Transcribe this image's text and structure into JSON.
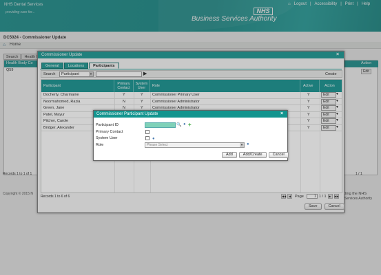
{
  "header": {
    "brand": "NHS Dental Services",
    "brand_sub": "providing care for...",
    "links": [
      "Logout",
      "Accessibility",
      "Print",
      "Help"
    ],
    "nhs_logo": "NHS",
    "org": "Business Services Authority"
  },
  "page": {
    "title": "DC5024 - Commissioner Update",
    "breadcrumb": "Home"
  },
  "background": {
    "tabs": [
      "Search",
      "Health Bo"
    ],
    "header_col": "Health Body Co",
    "header_action": "Action",
    "row_value": "Q59",
    "edit": "Edit",
    "records": "Records 1 to 1 of 1",
    "pager": "1 / 1",
    "copyright": "Copyright © 2015 N",
    "footer_right": "ecting the NHS",
    "footer_right2": "Services Authority"
  },
  "dialog": {
    "title": "Commissioner Update",
    "tabs": [
      "General",
      "Locations",
      "Participants"
    ],
    "active_tab": "Participants",
    "search_label": "Search",
    "search_select": "Participant",
    "search_value": "",
    "create": "Create",
    "columns": [
      "Participant",
      "Primary Contact",
      "System User",
      "Role",
      "Active",
      "Action"
    ],
    "rows": [
      {
        "participant": "Docherty, Charmaine",
        "primary": "Y",
        "system": "Y",
        "role": "Commissioner Primary User",
        "active": "Y",
        "action": "Edit"
      },
      {
        "participant": "Noormahomed, Razia",
        "primary": "N",
        "system": "Y",
        "role": "Commissioner Administrator",
        "active": "Y",
        "action": "Edit"
      },
      {
        "participant": "Green, Jane",
        "primary": "N",
        "system": "Y",
        "role": "Commissioner Administrator",
        "active": "Y",
        "action": "Edit"
      },
      {
        "participant": "Patel, Mayur",
        "primary": "",
        "system": "",
        "role": "",
        "active": "Y",
        "action": "Edit"
      },
      {
        "participant": "Pitcher, Carole",
        "primary": "",
        "system": "",
        "role": "",
        "active": "Y",
        "action": "Edit"
      },
      {
        "participant": "Bridger, Alexander",
        "primary": "",
        "system": "",
        "role": "",
        "active": "Y",
        "action": "Edit"
      }
    ],
    "records": "Records 1 to 6 of 6",
    "page_label": "Page",
    "page_value": "1",
    "page_total": "1 / 1",
    "save": "Save",
    "cancel": "Cancel"
  },
  "participant_dialog": {
    "title": "Commissioner Participant Update",
    "labels": {
      "participant_id": "Participant ID",
      "primary_contact": "Primary Contact",
      "system_user": "System User",
      "role": "Role"
    },
    "participant_id_value": "",
    "role_placeholder": "Please Select",
    "buttons": {
      "add": "Add",
      "add_create": "Add/Create",
      "cancel": "Cancel"
    }
  },
  "colors": {
    "teal": "#0f8f8c",
    "accent_green": "#7fd1b8"
  }
}
